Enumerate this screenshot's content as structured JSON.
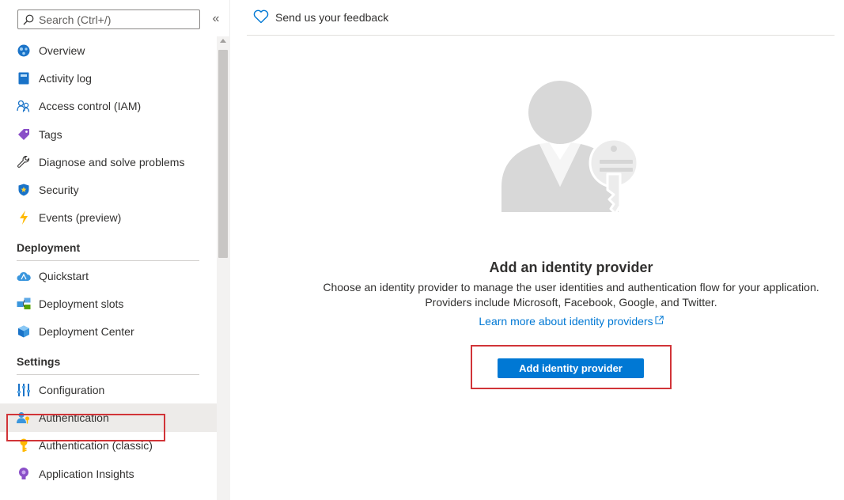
{
  "search": {
    "placeholder": "Search (Ctrl+/)"
  },
  "sidebar": {
    "collapse_label": "«",
    "general": [
      {
        "label": "Overview",
        "icon": "overview-globe-icon"
      },
      {
        "label": "Activity log",
        "icon": "activity-log-icon"
      },
      {
        "label": "Access control (IAM)",
        "icon": "people-icon"
      },
      {
        "label": "Tags",
        "icon": "tag-icon"
      },
      {
        "label": "Diagnose and solve problems",
        "icon": "wrench-icon"
      },
      {
        "label": "Security",
        "icon": "shield-icon"
      },
      {
        "label": "Events (preview)",
        "icon": "lightning-icon"
      }
    ],
    "deployment": {
      "title": "Deployment",
      "items": [
        {
          "label": "Quickstart",
          "icon": "cloud-icon"
        },
        {
          "label": "Deployment slots",
          "icon": "slots-icon"
        },
        {
          "label": "Deployment Center",
          "icon": "cube-icon"
        }
      ]
    },
    "settings": {
      "title": "Settings",
      "items": [
        {
          "label": "Configuration",
          "icon": "sliders-icon"
        },
        {
          "label": "Authentication",
          "icon": "user-key-icon",
          "selected": true
        },
        {
          "label": "Authentication (classic)",
          "icon": "key-icon"
        },
        {
          "label": "Application Insights",
          "icon": "lightbulb-icon"
        }
      ]
    }
  },
  "toolbar": {
    "feedback_label": "Send us your feedback"
  },
  "empty_state": {
    "title": "Add an identity provider",
    "description_line1": "Choose an identity provider to manage the user identities and authentication flow for your application.",
    "description_line2": "Providers include Microsoft, Facebook, Google, and Twitter.",
    "learn_more": "Learn more about identity providers",
    "button": "Add identity provider"
  },
  "colors": {
    "accent": "#0078d4",
    "highlight": "#d13438",
    "selected_bg": "#edebe9"
  }
}
